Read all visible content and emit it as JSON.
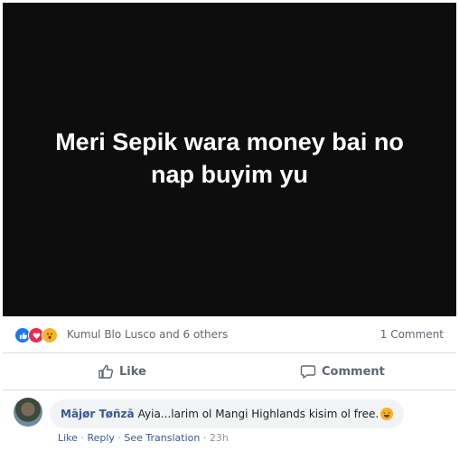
{
  "post": {
    "image_text": "Meri Sepik wara money bai no nap buyim yu"
  },
  "stats": {
    "reactors": "Kumul Blo Lusco and 6 others",
    "comment_count": "1 Comment",
    "reaction_icons": [
      "like-icon",
      "love-icon",
      "wow-icon"
    ]
  },
  "actions": {
    "like_label": "Like",
    "comment_label": "Comment"
  },
  "comment": {
    "author": "Mājør Tøñzā",
    "text": "Ayia...larim ol Mangi Highlands kisim ol free.",
    "like": "Like",
    "reply": "Reply",
    "see_translation": "See Translation",
    "time": "23h",
    "separator": " · "
  },
  "colors": {
    "like_blue": "#1877f2",
    "love_red": "#f0284a",
    "wow_yellow": "#f7b125",
    "link_blue": "#385898"
  }
}
